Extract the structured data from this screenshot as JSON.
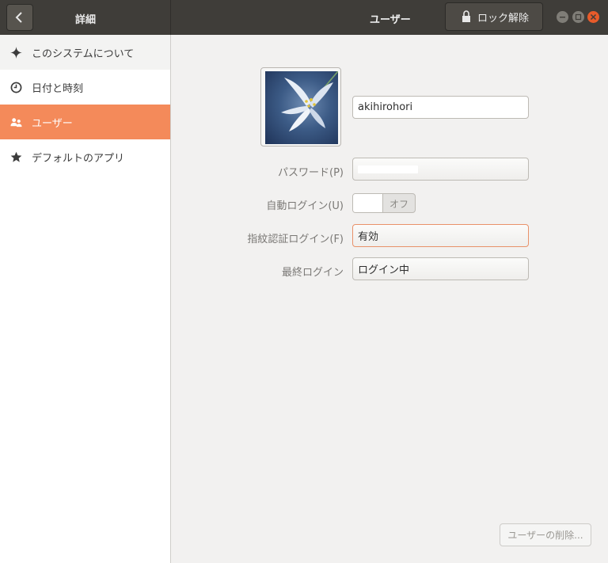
{
  "header": {
    "left_title": "詳細",
    "title": "ユーザー",
    "unlock_label": "ロック解除"
  },
  "sidebar": {
    "items": [
      {
        "label": "このシステムについて",
        "icon": "sparkle-icon"
      },
      {
        "label": "日付と時刻",
        "icon": "clock-icon"
      },
      {
        "label": "ユーザー",
        "icon": "users-icon",
        "active": true
      },
      {
        "label": "デフォルトのアプリ",
        "icon": "star-icon"
      }
    ]
  },
  "user": {
    "username": "akihirohori",
    "password_label": "パスワード(P)",
    "autologin_label": "自動ログイン(U)",
    "autologin_state": "オフ",
    "fingerprint_label": "指紋認証ログイン(F)",
    "fingerprint_value": "有効",
    "last_login_label": "最終ログイン",
    "last_login_value": "ログイン中"
  },
  "footer": {
    "delete_label": "ユーザーの削除..."
  },
  "colors": {
    "headerbar": "#3f3d39",
    "accent": "#f48a5a",
    "close": "#e75b2a"
  }
}
